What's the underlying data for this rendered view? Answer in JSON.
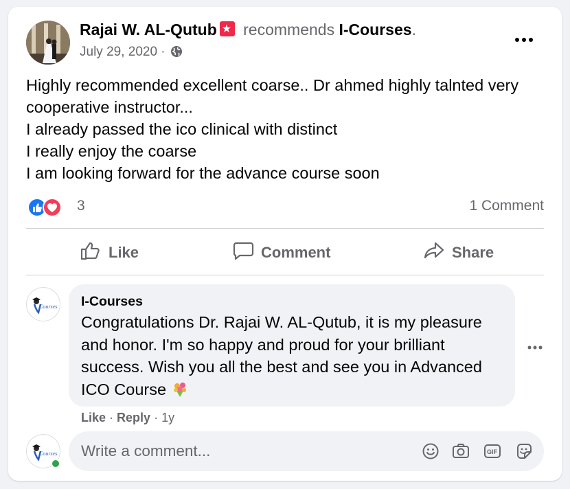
{
  "post": {
    "author": "Rajai W. AL-Qutub",
    "action": "recommends",
    "page": "I-Courses",
    "period": ".",
    "date": "July 29, 2020 ·",
    "text_lines": [
      "Highly recommended excellent coarse.. Dr ahmed highly talnted very",
      "cooperative instructor...",
      "I already passed the ico clinical with distinct",
      "I really enjoy the coarse",
      "I am looking forward for the advance course soon"
    ],
    "reaction_count": "3",
    "comment_count": "1 Comment"
  },
  "actions": {
    "like": "Like",
    "comment": "Comment",
    "share": "Share"
  },
  "comment": {
    "author": "I-Courses",
    "text_lines": [
      "Congratulations Dr. Rajai W. AL-Qutub, it is my pleasure",
      "and honor. I'm so happy and proud for your brilliant",
      "success. Wish you all the best and see you in Advanced",
      "ICO Course"
    ],
    "like": "Like",
    "sep1": " · ",
    "reply": "Reply",
    "sep2": " · ",
    "time": "1y"
  },
  "composer": {
    "placeholder": "Write a comment..."
  },
  "icons": [
    "badge-icon",
    "globe-icon",
    "more-icon",
    "like-reaction-icon",
    "love-reaction-icon",
    "thumbs-up-icon",
    "comment-icon",
    "share-icon",
    "flower-emoji-icon",
    "emoji-icon",
    "camera-icon",
    "gif-icon",
    "sticker-icon"
  ],
  "colors": {
    "link": "#1877f2",
    "love": "#f33e58",
    "online": "#31a24c",
    "secondary": "#65676b"
  }
}
